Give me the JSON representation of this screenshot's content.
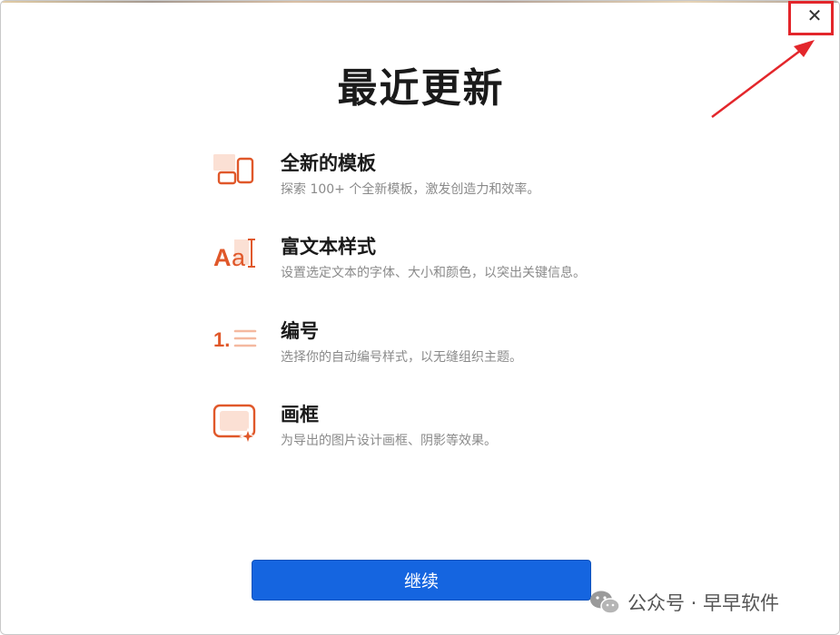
{
  "dialog": {
    "title": "最近更新",
    "close_symbol": "✕",
    "features": [
      {
        "icon": "template-icon",
        "title": "全新的模板",
        "description": "探索 100+ 个全新模板，激发创造力和效率。"
      },
      {
        "icon": "rich-text-icon",
        "title": "富文本样式",
        "description": "设置选定文本的字体、大小和颜色，以突出关键信息。"
      },
      {
        "icon": "numbering-icon",
        "title": "编号",
        "description": "选择你的自动编号样式，以无缝组织主题。"
      },
      {
        "icon": "frame-icon",
        "title": "画框",
        "description": "为导出的图片设计画框、阴影等效果。"
      }
    ],
    "continue_label": "继续"
  },
  "annotation": {
    "highlight_color": "#e3262b"
  },
  "watermark": {
    "text": "公众号 · 早早软件"
  },
  "colors": {
    "accent_orange": "#e0582a",
    "button_blue": "#1565e0"
  }
}
